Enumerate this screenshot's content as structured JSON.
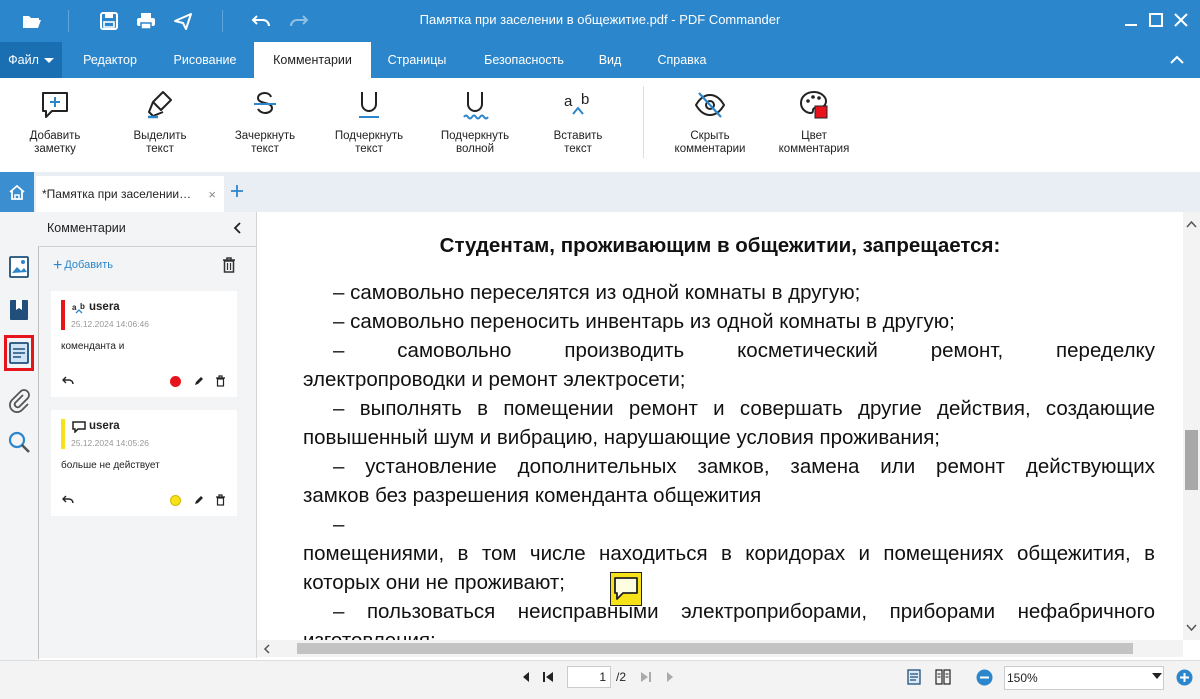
{
  "window": {
    "title": "Памятка при заселении в общежитие.pdf - PDF Commander"
  },
  "menu": {
    "file_label": "Файл",
    "tabs": [
      "Редактор",
      "Рисование",
      "Комментарии",
      "Страницы",
      "Безопасность",
      "Вид",
      "Справка"
    ],
    "active_tab": "Комментарии"
  },
  "ribbon": {
    "buttons": [
      {
        "l1": "Добавить",
        "l2": "заметку"
      },
      {
        "l1": "Выделить",
        "l2": "текст"
      },
      {
        "l1": "Зачеркнуть",
        "l2": "текст"
      },
      {
        "l1": "Подчеркнуть",
        "l2": "текст"
      },
      {
        "l1": "Подчеркнуть",
        "l2": "волной"
      },
      {
        "l1": "Вставить",
        "l2": "текст"
      },
      {
        "l1": "Скрыть",
        "l2": "комментарии"
      },
      {
        "l1": "Цвет",
        "l2": "комментария"
      }
    ]
  },
  "tabs": {
    "doc_tab_label": "*Памятка при заселении…",
    "close_glyph": "×"
  },
  "comments_panel": {
    "title": "Комментарии",
    "add_label": "Добавить",
    "comments": [
      {
        "user": "usera",
        "date": "25.12.2024 14:06:46",
        "text": "коменданта и",
        "color": "#e8141b"
      },
      {
        "user": "usera",
        "date": "25.12.2024 14:05:26",
        "text": "больше не действует",
        "color": "#f7e21a"
      }
    ]
  },
  "document": {
    "heading": "Студентам, проживающим в общежитии, запрещается:",
    "lines": [
      "–  самовольно переселятся из одной комнаты в другую;",
      "–  самовольно переносить инвентарь из одной комнаты в другую;",
      "– самовольно производить косметический ремонт, переделку",
      "электропроводки и ремонт электросети;",
      "–  выполнять в помещении ремонт и совершать другие действия, создающие",
      "повышенный шум и вибрацию, нарушающие условия проживания;",
      "–  установление дополнительных замков, замена или ремонт действующих",
      "замков без разрешения коменданта общежития",
      "–",
      "помещениями, в том числе находиться в коридорах и помещениях общежития, в",
      "которых они не проживают;",
      "–  пользоваться неисправными электроприборами, приборами нефабричного",
      "изготовления;"
    ]
  },
  "status": {
    "current_page": "1",
    "total_pages": "/2",
    "zoom": "150%"
  },
  "colors": {
    "accent": "#2b86cb",
    "highlight_red": "#e8141b",
    "note_yellow": "#f7e21a"
  }
}
